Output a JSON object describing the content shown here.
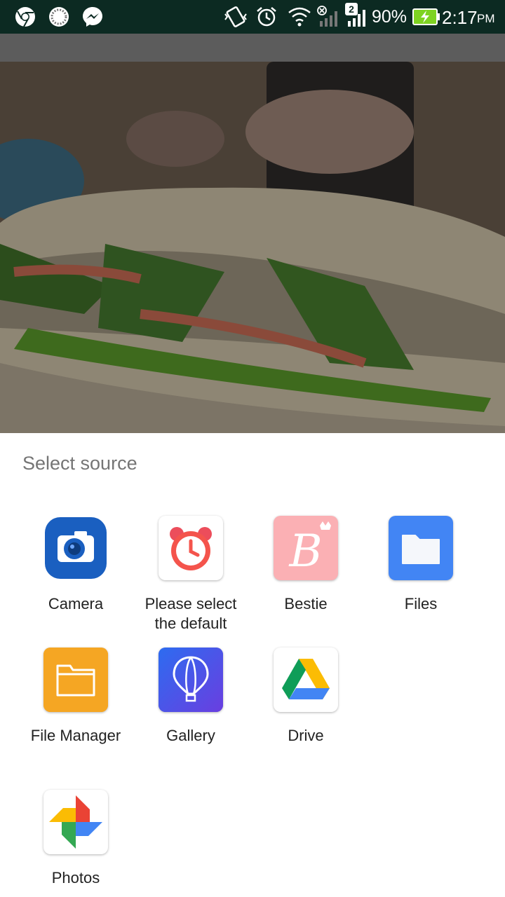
{
  "status_bar": {
    "notification_icons": [
      "chrome-icon",
      "sync-icon",
      "messenger-icon"
    ],
    "sim_badge": "2",
    "battery_percent": "90%",
    "time": "2:17",
    "time_suffix": "PM",
    "colors": {
      "background": "#0c2a22",
      "battery": "#7ed321"
    }
  },
  "sheet": {
    "title": "Select source",
    "apps": [
      {
        "label": "Camera",
        "icon": "camera-icon"
      },
      {
        "label": "Please select the default",
        "icon": "alarm-clock-icon"
      },
      {
        "label": "Bestie",
        "icon": "bestie-icon"
      },
      {
        "label": "Files",
        "icon": "folder-icon"
      },
      {
        "label": "File Manager",
        "icon": "file-manager-icon"
      },
      {
        "label": "Gallery",
        "icon": "balloon-icon"
      },
      {
        "label": "Drive",
        "icon": "drive-icon"
      },
      {
        "label": "Photos",
        "icon": "pinwheel-icon"
      }
    ]
  }
}
